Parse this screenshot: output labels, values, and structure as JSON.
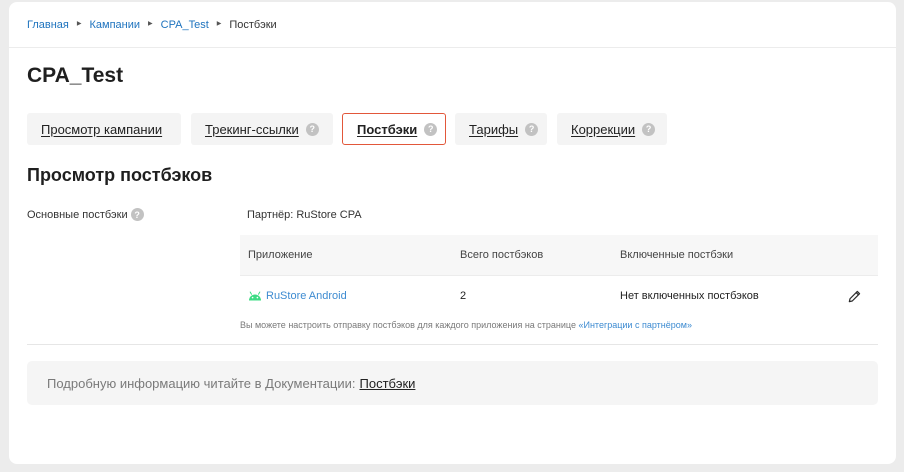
{
  "breadcrumb": {
    "items": [
      "Главная",
      "Кампании",
      "CPA_Test"
    ],
    "current": "Постбэки"
  },
  "page": {
    "title": "CPA_Test"
  },
  "tabs": [
    {
      "label": "Просмотр кампании",
      "help": false,
      "active": false
    },
    {
      "label": "Трекинг-ссылки",
      "help": true,
      "active": false
    },
    {
      "label": "Постбэки",
      "help": true,
      "active": true
    },
    {
      "label": "Тарифы",
      "help": true,
      "active": false
    },
    {
      "label": "Коррекции",
      "help": true,
      "active": false
    }
  ],
  "help_glyph": "?",
  "section": {
    "title": "Просмотр постбэков",
    "left_label": "Основные постбэки",
    "partner": "Партнёр: RuStore CPA"
  },
  "table": {
    "headers": [
      "Приложение",
      "Всего постбэков",
      "Включенные постбэки"
    ],
    "rows": [
      {
        "app": "RuStore Android",
        "total": "2",
        "enabled": "Нет включенных постбэков"
      }
    ]
  },
  "hint": {
    "text": "Вы можете настроить отправку постбэков для каждого приложения на странице ",
    "link": "«Интеграции с партнёром»"
  },
  "docs": {
    "text": "Подробную информацию читайте в Документации:",
    "link": "Постбэки"
  },
  "icons": {
    "breadcrumb_separator": "triangle-right-icon",
    "help": "question-circle-icon",
    "app": "android-icon",
    "edit": "pencil-icon"
  },
  "colors": {
    "link": "#1e73be",
    "active_tab_border": "#e2573a",
    "android": "#3ddc84"
  }
}
